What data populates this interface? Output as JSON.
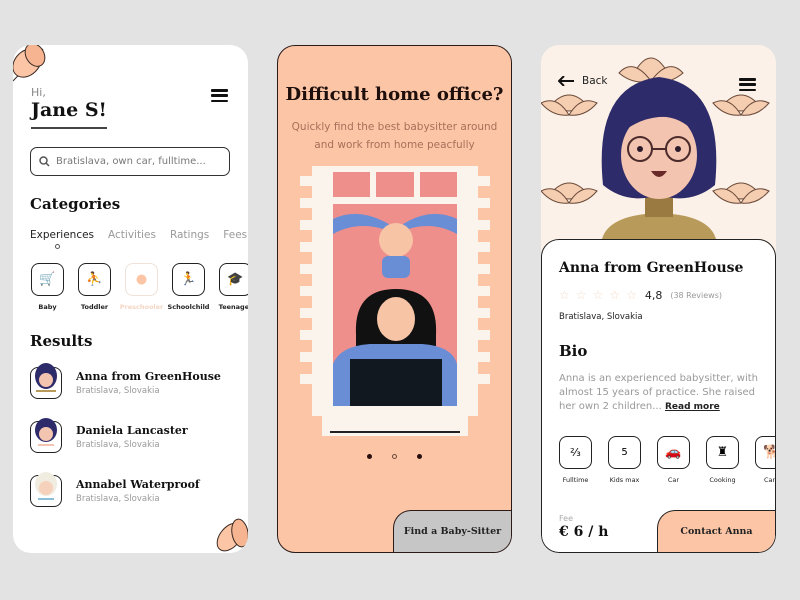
{
  "screen1": {
    "greeting": "Hi,",
    "user_name": "Jane S!",
    "search_placeholder": "Bratislava, own car, fulltime...",
    "categories_title": "Categories",
    "tabs": [
      {
        "label": "Experiences",
        "active": true
      },
      {
        "label": "Activities",
        "active": false
      },
      {
        "label": "Ratings",
        "active": false
      },
      {
        "label": "Fees",
        "active": false
      }
    ],
    "categories": [
      {
        "label": "Baby",
        "icon": "stroller-icon",
        "glyph": "🛒"
      },
      {
        "label": "Toddler",
        "icon": "crawling-icon",
        "glyph": "⛹"
      },
      {
        "label": "Preschooler",
        "icon": "child-icon",
        "glyph": "●"
      },
      {
        "label": "Schoolchild",
        "icon": "running-icon",
        "glyph": "🏃"
      },
      {
        "label": "Teenager",
        "icon": "graduation-cap-icon",
        "glyph": "🎓"
      }
    ],
    "results_title": "Results",
    "results": [
      {
        "name": "Anna from GreenHouse",
        "location": "Bratislava, Slovakia"
      },
      {
        "name": "Daniela Lancaster",
        "location": "Bratislava, Slovakia"
      },
      {
        "name": "Annabel  Waterproof",
        "location": "Bratislava, Slovakia"
      }
    ]
  },
  "screen2": {
    "title": "Difficult home office?",
    "subtitle_line1": "Quickly find the best babysitter around",
    "subtitle_line2": "and work from home peacfully",
    "carousel_pages": 3,
    "carousel_active_index": 1,
    "cta": "Find a Baby-Sitter"
  },
  "screen3": {
    "back_label": "Back",
    "name": "Anna from GreenHouse",
    "rating": "4,8",
    "reviews": "(38 Reviews)",
    "location": "Bratislava, Slovakia",
    "bio_title": "Bio",
    "bio_text": "Anna is an experienced babysitter, with almost 15 years of practice. She raised her own 2 children...",
    "read_more": "Read more",
    "features": [
      {
        "label": "Fulltime",
        "glyph": "⅔"
      },
      {
        "label": "Kids max",
        "glyph": "5"
      },
      {
        "label": "Car",
        "glyph": "🚗"
      },
      {
        "label": "Cooking",
        "glyph": "♜"
      },
      {
        "label": "Care",
        "glyph": "🐕"
      }
    ],
    "fee_label": "Fee",
    "fee_value": "€ 6 / h",
    "contact": "Contact Anna"
  },
  "colors": {
    "accent": "#fcc6a6",
    "button_grey": "#c6c6c6",
    "dark": "#222222"
  }
}
